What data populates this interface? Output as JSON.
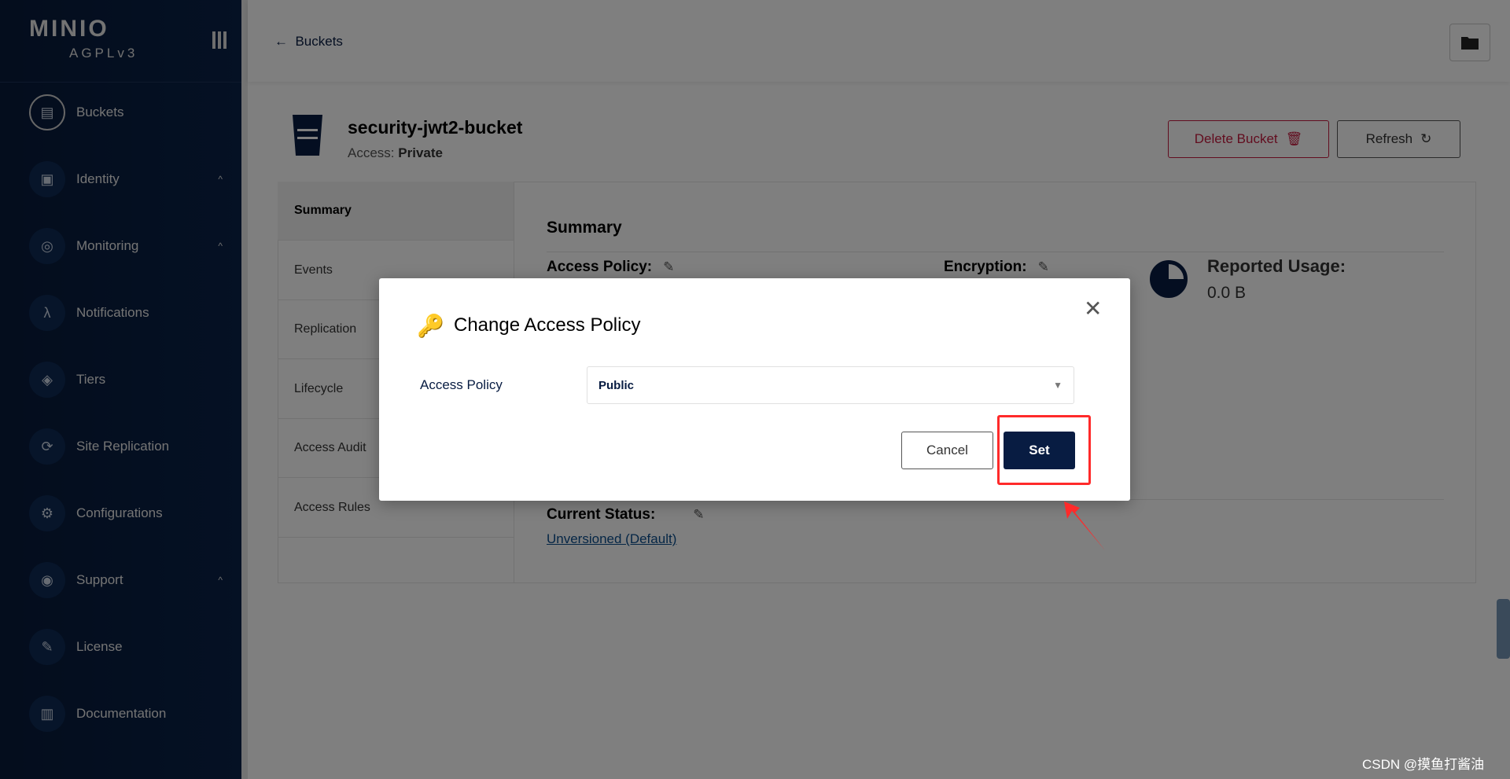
{
  "sidebar": {
    "logo": "MINIO",
    "license": "AGPLv3",
    "items": [
      {
        "label": "Buckets",
        "icon": "bucket-icon",
        "glyph": "▤"
      },
      {
        "label": "Identity",
        "icon": "id-card-icon",
        "glyph": "▣",
        "expand": true
      },
      {
        "label": "Monitoring",
        "icon": "monitoring-icon",
        "glyph": "◎",
        "expand": true
      },
      {
        "label": "Notifications",
        "icon": "lambda-icon",
        "glyph": "λ"
      },
      {
        "label": "Tiers",
        "icon": "layers-icon",
        "glyph": "◈"
      },
      {
        "label": "Site Replication",
        "icon": "sync-icon",
        "glyph": "⟳"
      },
      {
        "label": "Configurations",
        "icon": "gear-icon",
        "glyph": "⚙"
      },
      {
        "label": "Support",
        "icon": "support-icon",
        "glyph": "◉",
        "expand": true
      },
      {
        "label": "License",
        "icon": "license-icon",
        "glyph": "✎"
      },
      {
        "label": "Documentation",
        "icon": "documentation-icon",
        "glyph": "▥"
      }
    ]
  },
  "header": {
    "back_label": "Buckets"
  },
  "bucket": {
    "name": "security-jwt2-bucket",
    "access_label": "Access:",
    "access_value": "Private",
    "delete_label": "Delete Bucket",
    "refresh_label": "Refresh"
  },
  "tabs": [
    "Summary",
    "Events",
    "Replication",
    "Lifecycle",
    "Access Audit",
    "Access Rules"
  ],
  "summary": {
    "title": "Summary",
    "access_policy": "Access Policy:",
    "encryption": "Encryption:",
    "reported_usage": "Reported Usage:",
    "usage_value": "0.0 B",
    "current_status": "Current Status:",
    "versioning": "Unversioned (Default)"
  },
  "modal": {
    "title": "Change Access Policy",
    "field_label": "Access Policy",
    "selected": "Public",
    "cancel": "Cancel",
    "set": "Set"
  },
  "colors": {
    "brand": "#081c42",
    "danger": "#c51b3f",
    "annotation": "#ff2a2a"
  },
  "watermark": "CSDN @摸鱼打酱油"
}
